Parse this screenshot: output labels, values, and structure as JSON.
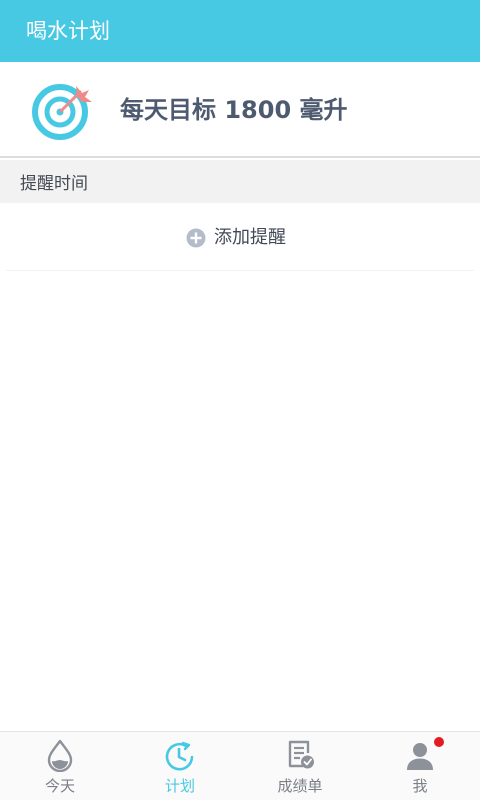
{
  "appbar": {
    "title": "喝水计划"
  },
  "goal": {
    "text": "每天目标 1800 毫升",
    "icon": "target-arrow-icon"
  },
  "reminders": {
    "section_title": "提醒时间",
    "add_label": "添加提醒",
    "add_icon": "plus-circle-icon"
  },
  "tabbar": {
    "active_index": 1,
    "tabs": [
      {
        "label": "今天",
        "icon": "water-drop-icon"
      },
      {
        "label": "计划",
        "icon": "clock-icon"
      },
      {
        "label": "成绩单",
        "icon": "report-check-icon"
      },
      {
        "label": "我",
        "icon": "user-icon",
        "badge": true
      }
    ]
  },
  "colors": {
    "primary": "#47c9e3",
    "goal_text": "#4e5a6f",
    "target_accent": "#ee8a8a",
    "tab_inactive": "#7b7f86",
    "badge": "#e31b23"
  }
}
